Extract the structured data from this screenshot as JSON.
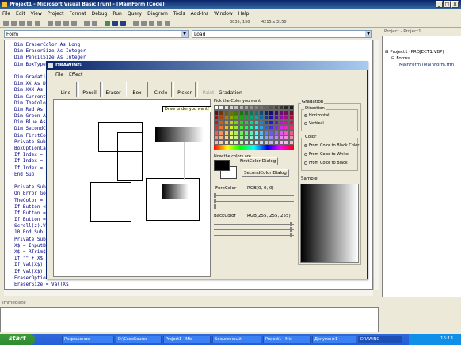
{
  "ide": {
    "title": "Project1 - Microsoft Visual Basic [run] - [MainForm (Code)]",
    "menu": [
      "File",
      "Edit",
      "View",
      "Project",
      "Format",
      "Debug",
      "Run",
      "Query",
      "Diagram",
      "Tools",
      "Add-Ins",
      "Window",
      "Help"
    ],
    "position_readout": "3035, 150",
    "size_readout": "4215 x 3150",
    "object_combo": "Form",
    "proc_combo": "Load"
  },
  "code_lines": [
    "Dim EraserColor As Long",
    "Dim EraserSize As Integer",
    "Dim PencilSize As Integer",
    "Dim BoxType",
    "",
    "Dim Gradatio",
    "Dim XX As Do",
    "Dim XXX As D",
    "Dim Currentl",
    "Dim TheColor",
    "Dim Red As",
    "Dim Green As",
    "Dim Blue As",
    "Dim SecondCo",
    "Dim FirstCol",
    "Private Sub",
    "BoxOptionCa",
    "If Index = C",
    "If Index = 1",
    "If Index = 2",
    "End Sub",
    "",
    "Private Sub",
    "On Error GoT",
    "TheColor =",
    "If Button <",
    "If Button =",
    "If Button =",
    "Scroll(z).Va",
    "10 End Sub",
    "Private Sub",
    "X$ = InputBo",
    "X$ = RTrim$(",
    "If \"\" + X$",
    "If Val(X$) <",
    "If Val(X$) >",
    "EraserOption",
    "EraserSize = Val(X$)"
  ],
  "project": {
    "title": "Project - Project1",
    "items": [
      "Project1 (PROJECT1.VBP)",
      "Forms",
      "MainForm (MainForm.frm)"
    ]
  },
  "immediate": {
    "title": "Immediate"
  },
  "drawing": {
    "title": "DRAWING",
    "menu": [
      "File",
      "Effect"
    ],
    "tools": [
      "Line",
      "Pencil",
      "Eraser",
      "Box",
      "Circle",
      "Picker",
      "Paint"
    ],
    "tooltip": "Draw under you want!",
    "gradation_tab": "Gradation",
    "palette_label": "Pick the Color you want",
    "swatch_label": "Now the colors are",
    "first_color_btn": "FirstColor Dialog",
    "second_color_btn": "SecondColor Dialog",
    "fore_color_label": "ForeColor",
    "fore_rgb": "RGB(0, 0, 0)",
    "back_color_label": "BackColor",
    "back_rgb": "RGB(255, 255, 255)",
    "grad_group": "Gradation",
    "direction_group": "Direction",
    "direction_options": [
      "Horizontal",
      "Vertical"
    ],
    "color_group": "Color",
    "color_options": [
      "From Color to Black Color",
      "From Color to White",
      "From Color to Black"
    ],
    "sample_label": "Sample"
  },
  "taskbar": {
    "start": "start",
    "tasks": [
      "Разрешение",
      "D:\\CodeSource",
      "Project1 - Mic",
      "Безымянный",
      "Project1 - Mic",
      "Документ1 - ",
      "DRAWING"
    ],
    "clock": "16:13"
  }
}
